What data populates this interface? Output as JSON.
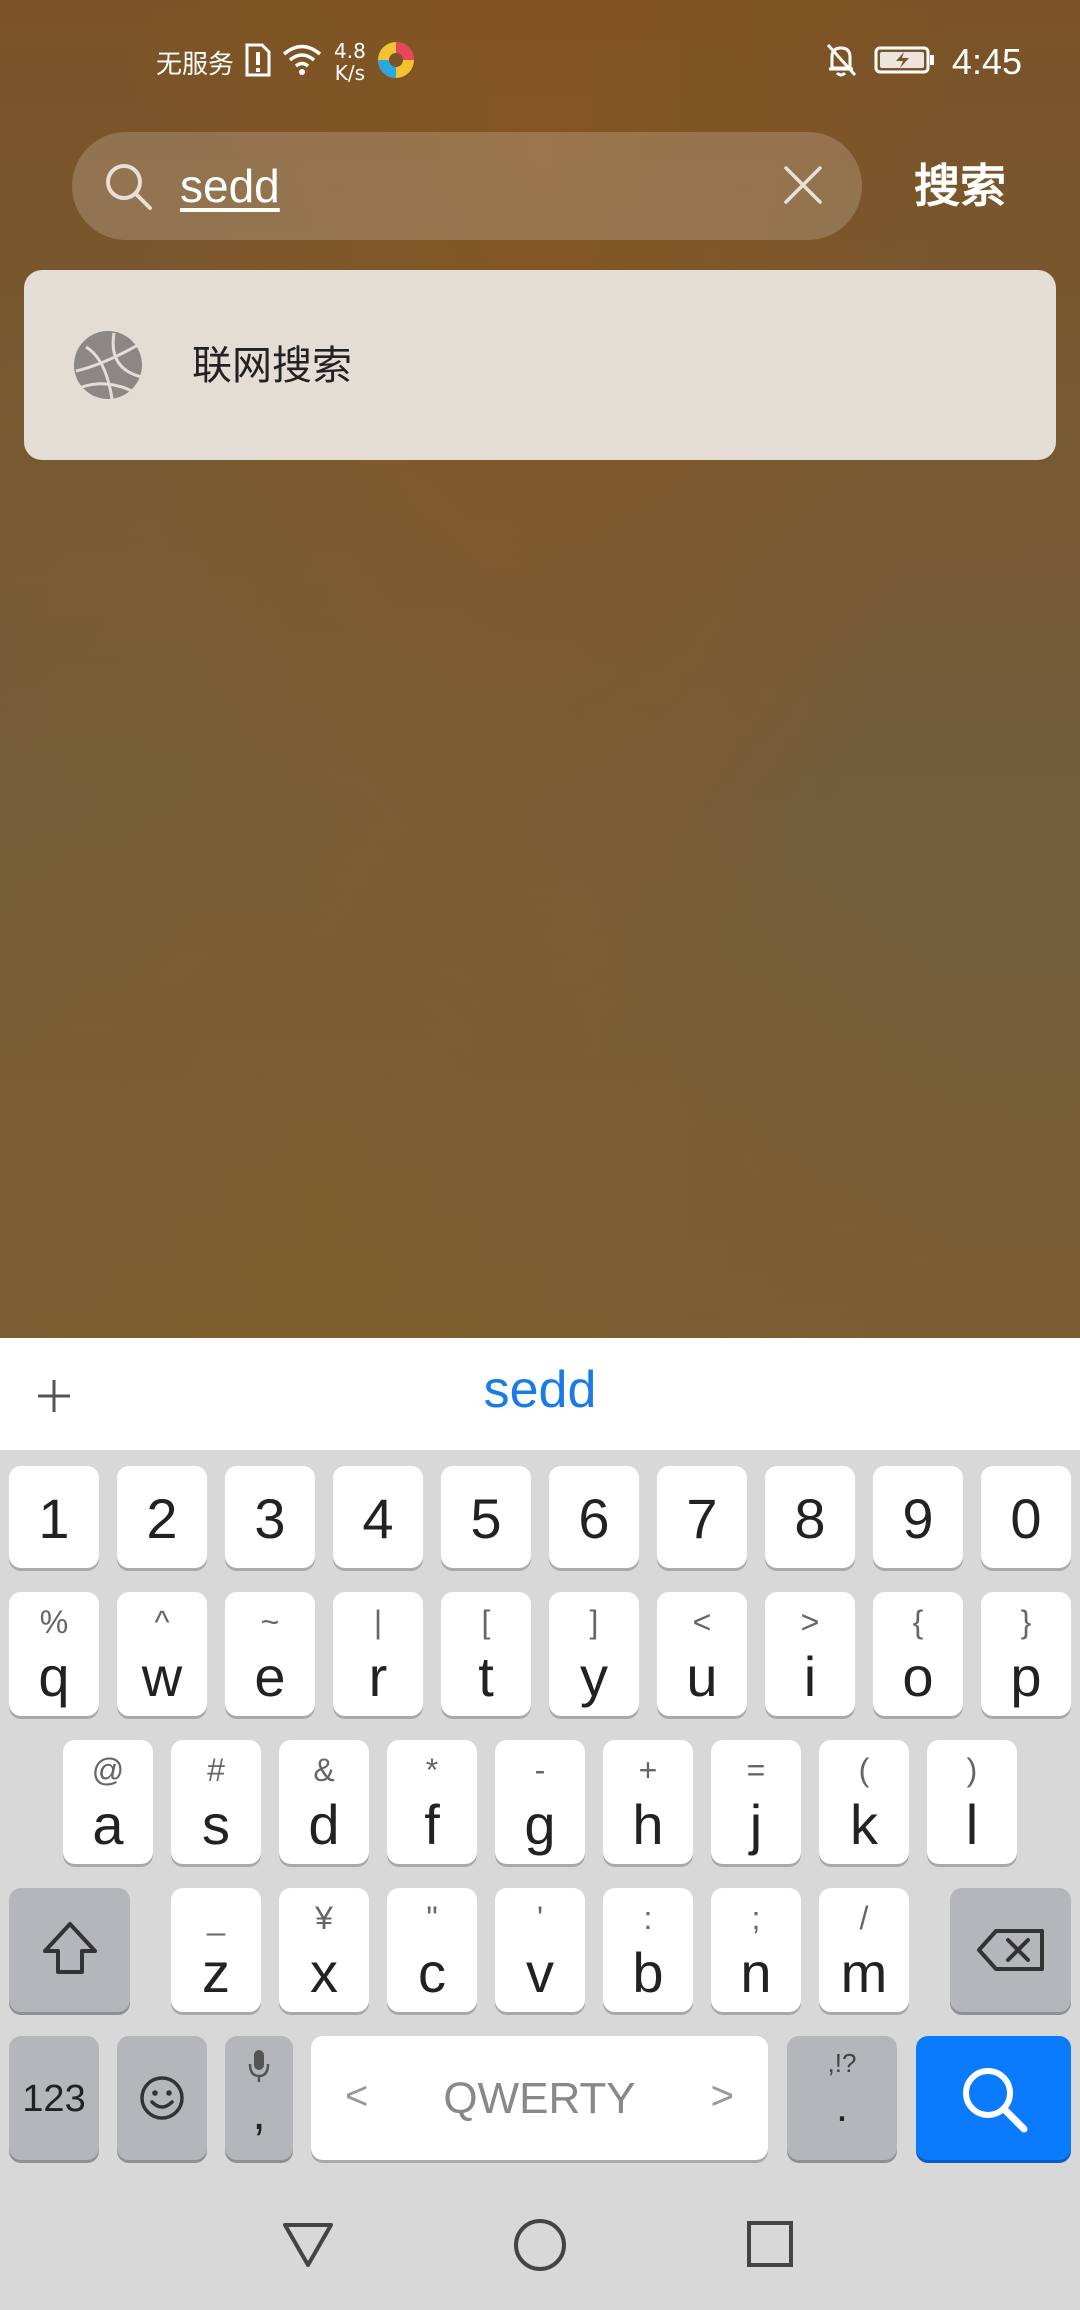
{
  "status_bar": {
    "carrier": "无服务",
    "net_speed_value": "4.8",
    "net_speed_unit": "K/s",
    "time": "4:45",
    "icons": [
      "sim-alert-icon",
      "wifi-icon",
      "browser-app-icon",
      "bell-muted-icon",
      "battery-charging-icon"
    ]
  },
  "search": {
    "query": "sedd",
    "action_label": "搜索"
  },
  "suggestion": {
    "label": "联网搜索",
    "icon": "globe-icon"
  },
  "keyboard": {
    "candidate": "sedd",
    "number_row": [
      "1",
      "2",
      "3",
      "4",
      "5",
      "6",
      "7",
      "8",
      "9",
      "0"
    ],
    "row1": [
      {
        "main": "q",
        "sub": "%"
      },
      {
        "main": "w",
        "sub": "^"
      },
      {
        "main": "e",
        "sub": "~"
      },
      {
        "main": "r",
        "sub": "|"
      },
      {
        "main": "t",
        "sub": "["
      },
      {
        "main": "y",
        "sub": "]"
      },
      {
        "main": "u",
        "sub": "<"
      },
      {
        "main": "i",
        "sub": ">"
      },
      {
        "main": "o",
        "sub": "{"
      },
      {
        "main": "p",
        "sub": "}"
      }
    ],
    "row2": [
      {
        "main": "a",
        "sub": "@"
      },
      {
        "main": "s",
        "sub": "#"
      },
      {
        "main": "d",
        "sub": "&"
      },
      {
        "main": "f",
        "sub": "*"
      },
      {
        "main": "g",
        "sub": "-"
      },
      {
        "main": "h",
        "sub": "+"
      },
      {
        "main": "j",
        "sub": "="
      },
      {
        "main": "k",
        "sub": "("
      },
      {
        "main": "l",
        "sub": ")"
      }
    ],
    "row3": [
      {
        "main": "z",
        "sub": "_"
      },
      {
        "main": "x",
        "sub": "¥"
      },
      {
        "main": "c",
        "sub": "\""
      },
      {
        "main": "v",
        "sub": "'"
      },
      {
        "main": "b",
        "sub": ":"
      },
      {
        "main": "n",
        "sub": ";"
      },
      {
        "main": "m",
        "sub": "/"
      }
    ],
    "numbers_label": "123",
    "voice_label": ",",
    "space_label": "QWERTY",
    "space_left": "<",
    "space_right": ">",
    "punct_main": ".",
    "punct_sub": ",!?",
    "accent_color": "#0a7aff"
  },
  "navbar": {
    "icons": [
      "back-triangle-icon",
      "home-circle-icon",
      "recents-square-icon"
    ]
  }
}
